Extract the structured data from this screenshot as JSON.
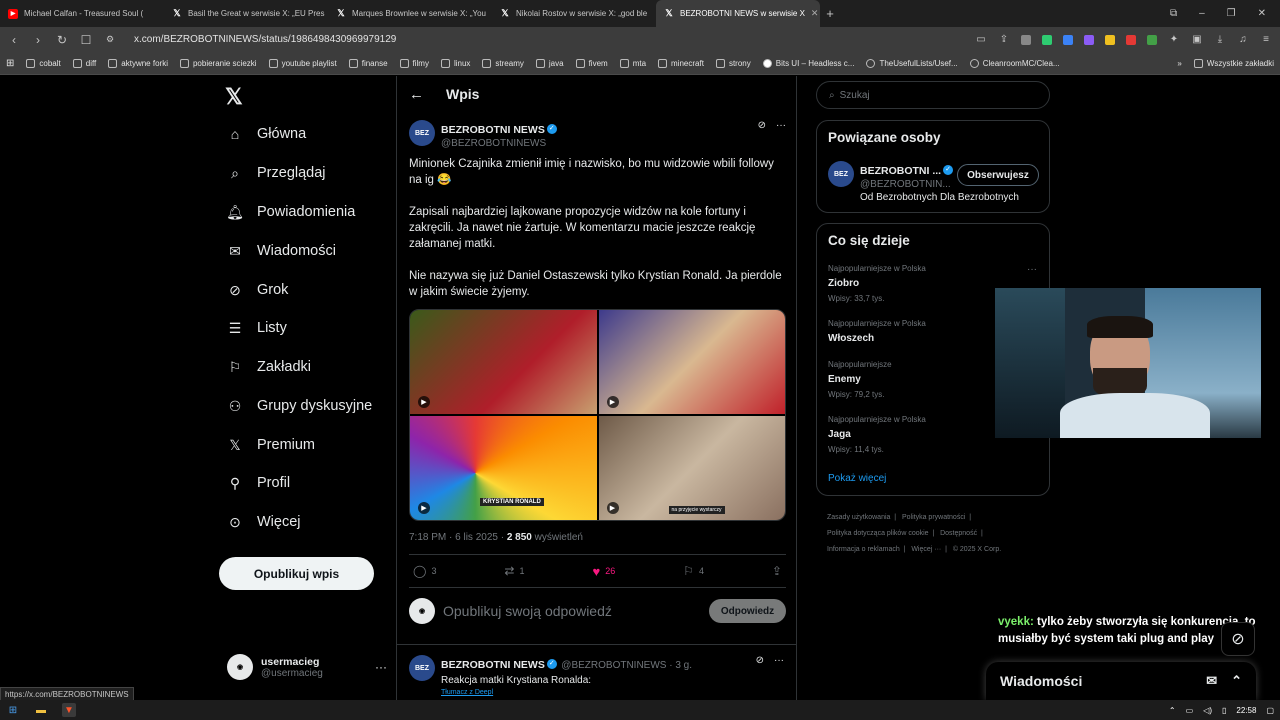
{
  "browser": {
    "tabs": [
      {
        "title": "Michael Calfan - Treasured Soul (",
        "icon": "youtube-icon",
        "icon_color": "#ff0000"
      },
      {
        "title": "Basil the Great w serwisie X: „EU Pres",
        "icon": "x-logo-icon"
      },
      {
        "title": "Marques Brownlee w serwisie X: „You",
        "icon": "x-logo-icon"
      },
      {
        "title": "Nikolai Rostov w serwisie X: „god ble",
        "icon": "x-logo-icon"
      },
      {
        "title": "BEZROBOTNI NEWS w serwisie X",
        "icon": "x-logo-icon",
        "active": true
      }
    ],
    "new_tab": "+",
    "url": "x.com/BEZROBOTNINEWS/status/1986498430969979129",
    "bookmarks": [
      "cobalt",
      "diff",
      "aktywne forki",
      "pobieranie sciezki",
      "youtube playlist",
      "finanse",
      "filmy",
      "linux",
      "streamy",
      "java",
      "fivem",
      "mta",
      "minecraft",
      "strony",
      "Bits UI – Headless c...",
      "TheUsefulLists/Usef...",
      "CleanroomMC/Clea..."
    ],
    "all_bookmarks": "Wszystkie zakładki"
  },
  "nav": {
    "items": [
      {
        "label": "Główna",
        "icon": "home-icon"
      },
      {
        "label": "Przeglądaj",
        "icon": "search-icon"
      },
      {
        "label": "Powiadomienia",
        "icon": "bell-icon"
      },
      {
        "label": "Wiadomości",
        "icon": "envelope-icon"
      },
      {
        "label": "Grok",
        "icon": "grok-icon"
      },
      {
        "label": "Listy",
        "icon": "list-icon"
      },
      {
        "label": "Zakładki",
        "icon": "bookmark-icon"
      },
      {
        "label": "Grupy dyskusyjne",
        "icon": "people-icon"
      },
      {
        "label": "Premium",
        "icon": "x-logo-icon"
      },
      {
        "label": "Profil",
        "icon": "person-icon"
      },
      {
        "label": "Więcej",
        "icon": "more-circle-icon"
      }
    ],
    "post_button": "Opublikuj wpis",
    "account": {
      "name": "usermacieg",
      "handle": "@usermacieg"
    }
  },
  "main": {
    "header": "Wpis",
    "tweet": {
      "name": "BEZROBOTNI NEWS",
      "handle": "@BEZROBOTNINEWS",
      "p1": "Minionek Czajnika zmienił imię i nazwisko, bo mu widzowie wbili followy na ig 😂",
      "p2": "Zapisali najbardziej lajkowane propozycje widzów na kole fortuny i zakręcili. Ja nawet nie żartuje. W komentarzu macie jeszcze reakcję załamanej matki.",
      "p3": "Nie nazywa się już Daniel Ostaszewski tylko Krystian Ronald. Ja pierdole w jakim świecie żyjemy.",
      "media_captions": [
        "KRYSTIAN RONALD",
        "na przyjęcie wystarczy"
      ],
      "time": "7:18 PM · 6 lis 2025 · ",
      "views": "2 850",
      "views_label": " wyświetleń",
      "replies": "3",
      "retweets": "1",
      "likes": "26",
      "bookmarks": "4"
    },
    "reply_placeholder": "Opublikuj swoją odpowiedź",
    "reply_button": "Odpowiedz",
    "reply_tweet": {
      "name": "BEZROBOTNI NEWS",
      "handle": "@BEZROBOTNINEWS · 3 g.",
      "text": "Reakcja matki Krystiana Ronalda:",
      "translate": "Tłumacz z Deepl"
    }
  },
  "right": {
    "search_placeholder": "Szukaj",
    "related_title": "Powiązane osoby",
    "related": {
      "name": "BEZROBOTNI ...",
      "handle": "@BEZROBOTNIN...",
      "bio": "Od Bezrobotnych Dla Bezrobotnych",
      "follow": "Obserwujesz"
    },
    "trends_title": "Co się dzieje",
    "trends": [
      {
        "category": "Najpopularniejsze w Polska",
        "name": "Ziobro",
        "count": "Wpisy: 33,7 tys."
      },
      {
        "category": "Najpopularniejsze w Polska",
        "name": "Włoszech",
        "count": ""
      },
      {
        "category": "Najpopularniejsze",
        "name": "Enemy",
        "count": "Wpisy: 79,2 tys."
      },
      {
        "category": "Najpopularniejsze w Polska",
        "name": "Jaga",
        "count": "Wpisy: 11,4 tys."
      }
    ],
    "show_more": "Pokaż więcej",
    "footer": [
      "Zasady użytkowania",
      "Polityka prywatności",
      "Polityka dotycząca plików cookie",
      "Dostępność",
      "Informacja o reklamach",
      "Więcej ···",
      "© 2025 X Corp."
    ]
  },
  "overlay": {
    "chat_user": "vyekk:",
    "chat_text": " tylko żeby stworzyła się konkurencja, to musiałby być system taki plug and play"
  },
  "messages_drawer": "Wiadomości",
  "status_url": "https://x.com/BEZROBOTNINEWS",
  "taskbar": {
    "time": "22:58"
  },
  "colors": {
    "accent": "#1d9bf0",
    "like": "#f91880",
    "bg": "#000000",
    "text": "#e7e9ea",
    "muted": "#71767b"
  }
}
